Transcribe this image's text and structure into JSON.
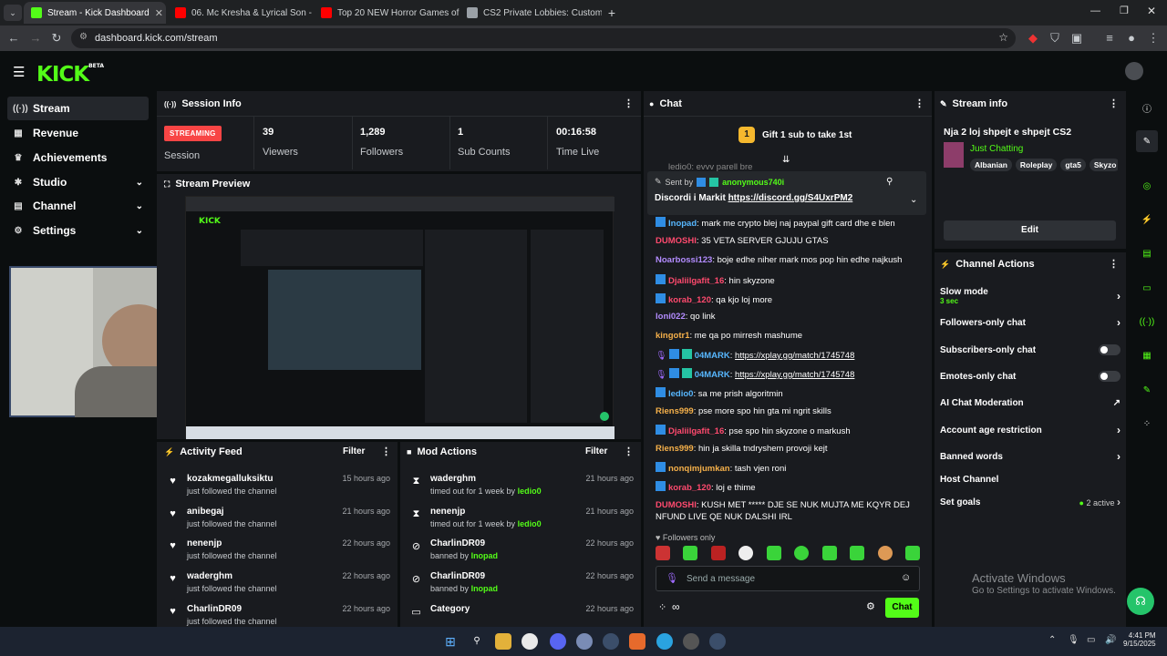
{
  "browser": {
    "tabs": [
      {
        "label": "Stream - Kick Dashboard",
        "color": "#53fc18"
      },
      {
        "label": "06. Mc Kresha & Lyrical Son - M",
        "color": "#ff0000"
      },
      {
        "label": "Top 20 NEW Horror Games of 2",
        "color": "#ff0000"
      },
      {
        "label": "CS2 Private Lobbies: Custom M",
        "color": "#9aa0a6"
      }
    ],
    "url": "dashboard.kick.com/stream"
  },
  "brand": {
    "logo": "KICK",
    "logo_sup": "BETA"
  },
  "sidebar": {
    "items": [
      {
        "label": "Stream",
        "icon": "broadcast-icon"
      },
      {
        "label": "Revenue",
        "icon": "revenue-icon"
      },
      {
        "label": "Achievements",
        "icon": "trophy-icon"
      },
      {
        "label": "Studio",
        "icon": "studio-icon"
      },
      {
        "label": "Channel",
        "icon": "channel-icon"
      },
      {
        "label": "Settings",
        "icon": "gear-icon"
      }
    ]
  },
  "session": {
    "title": "Session Info",
    "status": "STREAMING",
    "status_label": "Session",
    "stats": [
      {
        "value": "39",
        "label": "Viewers"
      },
      {
        "value": "1,289",
        "label": "Followers"
      },
      {
        "value": "1",
        "label": "Sub Counts"
      },
      {
        "value": "00:16:58",
        "label": "Time Live"
      }
    ]
  },
  "preview": {
    "title": "Stream Preview"
  },
  "activity": {
    "title": "Activity Feed",
    "filter": "Filter",
    "items": [
      {
        "name": "kozakmegalluksiktu",
        "sub": "just followed the channel",
        "time": "15 hours ago"
      },
      {
        "name": "anibegaj",
        "sub": "just followed the channel",
        "time": "21 hours ago"
      },
      {
        "name": "nenenjp",
        "sub": "just followed the channel",
        "time": "22 hours ago"
      },
      {
        "name": "waderghm",
        "sub": "just followed the channel",
        "time": "22 hours ago"
      },
      {
        "name": "CharlinDR09",
        "sub": "just followed the channel",
        "time": "22 hours ago"
      }
    ]
  },
  "mod": {
    "title": "Mod Actions",
    "filter": "Filter",
    "items": [
      {
        "name": "waderghm",
        "sub": "timed out for 1 week by",
        "by": "ledio0",
        "time": "21 hours ago",
        "icon": "hourglass-icon"
      },
      {
        "name": "nenenjp",
        "sub": "timed out for 1 week by",
        "by": "ledio0",
        "time": "21 hours ago",
        "icon": "hourglass-icon"
      },
      {
        "name": "CharlinDR09",
        "sub": "banned by",
        "by": "Inopad",
        "time": "22 hours ago",
        "icon": "ban-icon"
      },
      {
        "name": "CharlinDR09",
        "sub": "banned by",
        "by": "Inopad",
        "time": "22 hours ago",
        "icon": "ban-icon"
      },
      {
        "name": "Category",
        "sub": "",
        "by": "",
        "time": "22 hours ago",
        "icon": "category-icon"
      }
    ]
  },
  "chat": {
    "title": "Chat",
    "gift": "Gift 1 sub to take 1st",
    "gift_rank": "1",
    "partial_top": "ledio0: evvv parell bre",
    "pinned_prefix": "Sent by",
    "pinned_user": "anonymous740i",
    "pinned_text": "Discordi i Markit ",
    "pinned_link": "https://discord.gg/S4UxrPM2",
    "messages": [
      {
        "user": "Inopad",
        "color": "#57b7ff",
        "text": "mark me crypto blej naj paypal gift card dhe e blen"
      },
      {
        "user": "DUMOSHI",
        "color": "#ff4a6e",
        "text": "35 VETA SERVER GJUJU GTAS"
      },
      {
        "user": "Noarbossi123",
        "color": "#b38cff",
        "text": "boje edhe niher mark mos pop hin edhe najkush"
      },
      {
        "user": "Djaliilgafit_16",
        "color": "#ff4a6e",
        "text": "hin skyzone"
      },
      {
        "user": "korab_120",
        "color": "#ff4a6e",
        "text": "qa kjo loj more"
      },
      {
        "user": "loni022",
        "color": "#b38cff",
        "text": "qo link"
      },
      {
        "user": "kingotr1",
        "color": "#f5b04a",
        "text": "me qa po mirresh mashume"
      },
      {
        "user": "04MARK",
        "color": "#57b7ff",
        "text": "",
        "link": "https://xplay.gg/match/1745748"
      },
      {
        "user": "04MARK",
        "color": "#57b7ff",
        "text": "",
        "link": "https://xplay.gg/match/1745748"
      },
      {
        "user": "ledio0",
        "color": "#57b7ff",
        "text": "sa me prish algoritmin"
      },
      {
        "user": "Riens999",
        "color": "#f5b04a",
        "text": "pse more spo hin gta mi ngrit skills"
      },
      {
        "user": "Djaliilgafit_16",
        "color": "#ff4a6e",
        "text": "pse spo hin skyzone o markush"
      },
      {
        "user": "Riens999",
        "color": "#f5b04a",
        "text": "hin ja skilla tndryshem provoji kejt"
      },
      {
        "user": "nonqimjumkan",
        "color": "#f5b04a",
        "text": "tash vjen roni"
      },
      {
        "user": "korab_120",
        "color": "#ff4a6e",
        "text": "loj e thime"
      },
      {
        "user": "DUMOSHI",
        "color": "#ff4a6e",
        "text": "KUSH MET ***** DJE SE NUK MUJTA ME KQYR DEJ",
        "cont": "NFUND LIVE QE NUK DALSHI IRL"
      }
    ],
    "followers_only": "Followers only",
    "placeholder": "Send a message",
    "send": "Chat"
  },
  "stream_info": {
    "title": "Stream info",
    "stream_title": "Nja 2 loj shpejt e shpejt CS2",
    "category": "Just Chatting",
    "tags": [
      "Albanian",
      "Roleplay",
      "gta5",
      "Skyzo"
    ],
    "edit": "Edit"
  },
  "channel_actions": {
    "title": "Channel Actions",
    "slow_mode": "Slow mode",
    "slow_value": "3 sec",
    "followers_only": "Followers-only chat",
    "subscribers_only": "Subscribers-only chat",
    "emotes_only": "Emotes-only chat",
    "ai_mod": "AI Chat Moderation",
    "age": "Account age restriction",
    "banned": "Banned words",
    "host": "Host Channel",
    "goals": "Set goals",
    "goals_active": "2 active"
  },
  "watermark": {
    "line1": "Activate Windows",
    "line2": "Go to Settings to activate Windows."
  },
  "taskbar": {
    "time": "4:41 PM",
    "date": "9/15/2025"
  },
  "colors": {
    "accent": "#53fc18",
    "panel": "#191b1f",
    "bg": "#0b0e0f",
    "live": "#f84545"
  }
}
